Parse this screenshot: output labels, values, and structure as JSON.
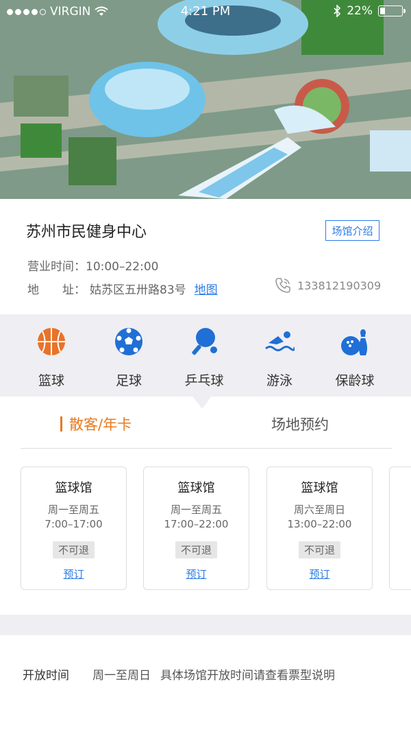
{
  "status_bar": {
    "carrier": "VIRGIN",
    "time": "4:21 PM",
    "battery": "22%",
    "battery_level": 0.22
  },
  "venue": {
    "name": "苏州市民健身中心",
    "intro_button": "场馆介绍",
    "hours_label": "营业时间：",
    "hours_value": "10:00–22:00",
    "address_label": "地　　址：",
    "address_value": "姑苏区五卅路83号",
    "map_link": "地图",
    "phone": "133812190309"
  },
  "sports": [
    {
      "label": "篮球",
      "icon": "basketball-icon"
    },
    {
      "label": "足球",
      "icon": "soccer-ball-icon"
    },
    {
      "label": "乒乓球",
      "icon": "ping-pong-icon"
    },
    {
      "label": "游泳",
      "icon": "swimming-icon"
    },
    {
      "label": "保龄球",
      "icon": "bowling-icon"
    }
  ],
  "tabs": [
    {
      "label": "散客/年卡",
      "active": true
    },
    {
      "label": "场地预约",
      "active": false
    }
  ],
  "tickets": [
    {
      "title": "篮球馆",
      "days": "周一至周五",
      "time": "7:00–17:00",
      "refund": "不可退",
      "book": "预订"
    },
    {
      "title": "篮球馆",
      "days": "周一至周五",
      "time": "17:00–22:00",
      "refund": "不可退",
      "book": "预订"
    },
    {
      "title": "篮球馆",
      "days": "周六至周日",
      "time": "13:00–22:00",
      "refund": "不可退",
      "book": "预订"
    }
  ],
  "open_time": {
    "label": "开放时间",
    "days": "周一至周日",
    "note": "具体场馆开放时间请查看票型说明"
  },
  "colors": {
    "accent_orange": "#e67a1e",
    "link_blue": "#2c7be5",
    "band_gray": "#efeef2"
  }
}
